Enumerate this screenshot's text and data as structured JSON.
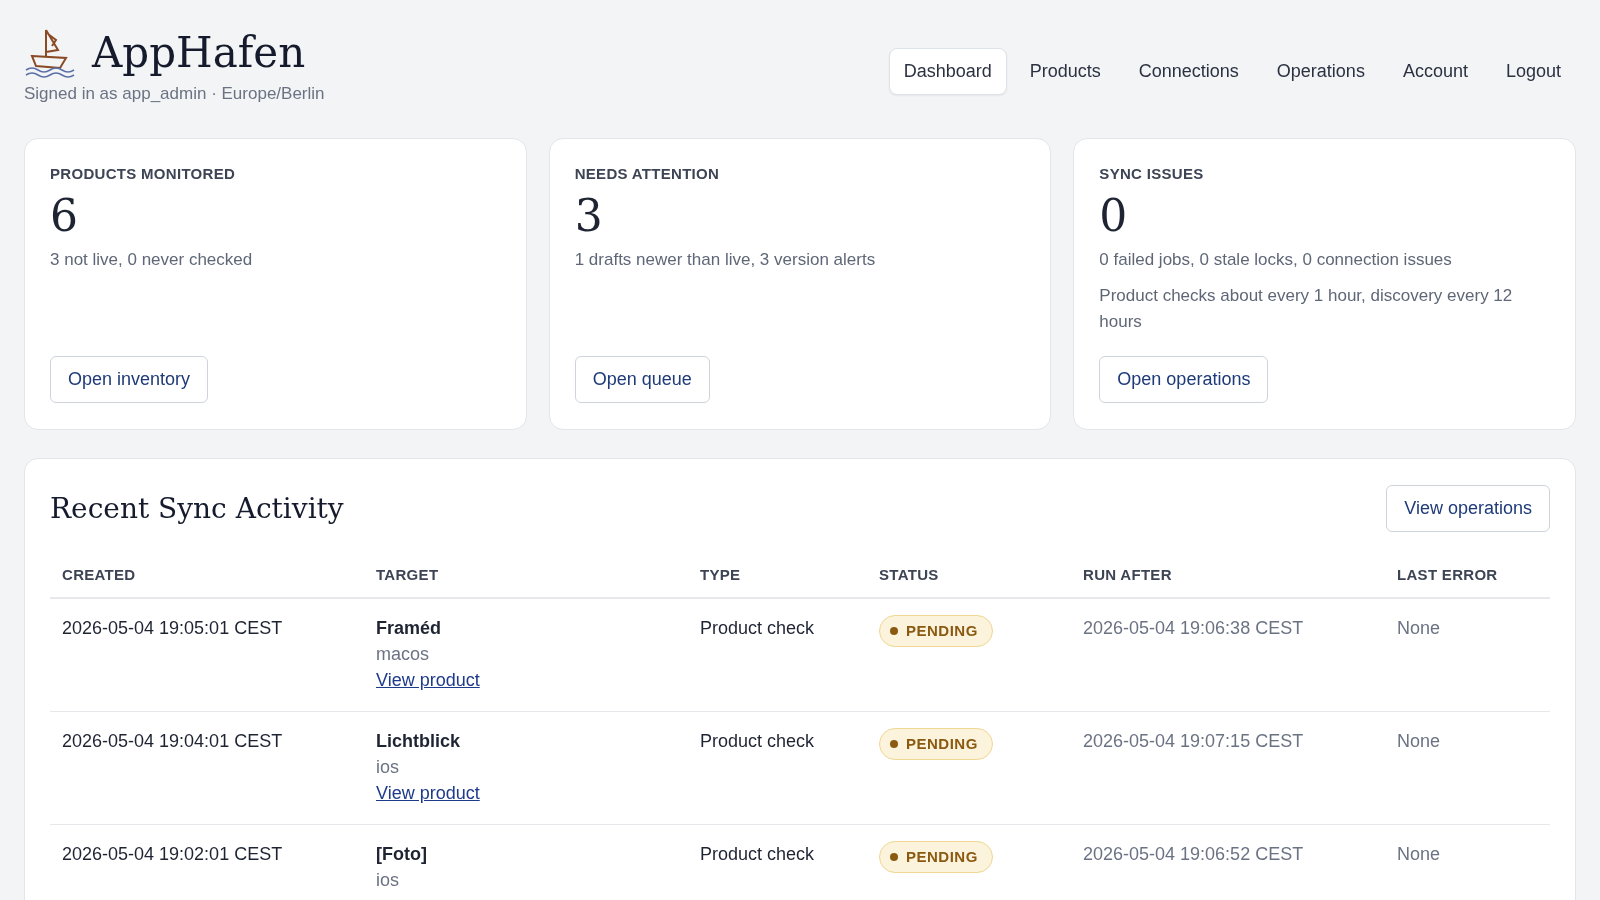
{
  "brand": {
    "name": "AppHafen",
    "subtitle": "Signed in as app_admin · Europe/Berlin"
  },
  "nav": [
    {
      "label": "Dashboard",
      "selected": true
    },
    {
      "label": "Products",
      "selected": false
    },
    {
      "label": "Connections",
      "selected": false
    },
    {
      "label": "Operations",
      "selected": false
    },
    {
      "label": "Account",
      "selected": false
    },
    {
      "label": "Logout",
      "selected": false
    }
  ],
  "cards": [
    {
      "title": "PRODUCTS MONITORED",
      "value": "6",
      "notes": [
        "3 not live, 0 never checked"
      ],
      "button": "Open inventory"
    },
    {
      "title": "NEEDS ATTENTION",
      "value": "3",
      "notes": [
        "1 drafts newer than live, 3 version alerts"
      ],
      "button": "Open queue"
    },
    {
      "title": "SYNC ISSUES",
      "value": "0",
      "notes": [
        "0 failed jobs, 0 stale locks, 0 connection issues",
        "Product checks about every 1 hour, discovery every 12 hours"
      ],
      "button": "Open operations"
    }
  ],
  "activity": {
    "title": "Recent Sync Activity",
    "button": "View operations",
    "columns": [
      "CREATED",
      "TARGET",
      "TYPE",
      "STATUS",
      "RUN AFTER",
      "LAST ERROR"
    ],
    "rows": [
      {
        "created": "2026-05-04 19:05:01 CEST",
        "target": "Framéd",
        "platform": "macos",
        "link": "View product",
        "type": "Product check",
        "status": {
          "kind": "pending",
          "label": "PENDING"
        },
        "run_after": "2026-05-04 19:06:38 CEST",
        "last_error": "None"
      },
      {
        "created": "2026-05-04 19:04:01 CEST",
        "target": "Lichtblick",
        "platform": "ios",
        "link": "View product",
        "type": "Product check",
        "status": {
          "kind": "pending",
          "label": "PENDING"
        },
        "run_after": "2026-05-04 19:07:15 CEST",
        "last_error": "None"
      },
      {
        "created": "2026-05-04 19:02:01 CEST",
        "target": "[Foto]",
        "platform": "ios",
        "type": "Product check",
        "status": {
          "kind": "pending",
          "label": "PENDING"
        },
        "run_after": "2026-05-04 19:06:52 CEST",
        "last_error": "None"
      }
    ]
  }
}
